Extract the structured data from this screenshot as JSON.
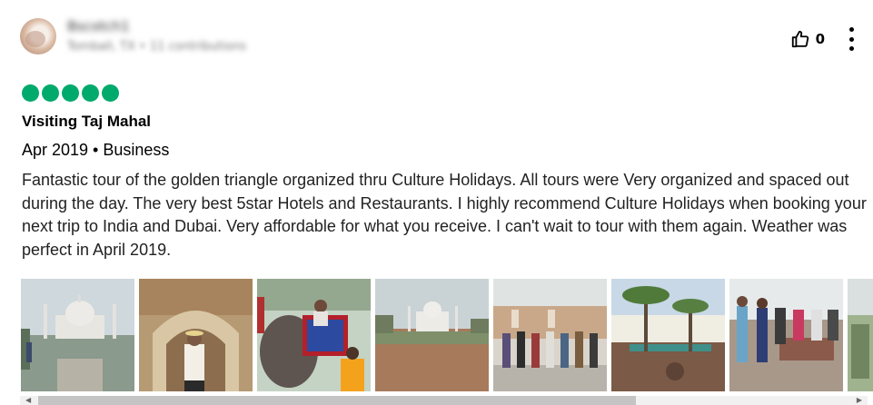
{
  "reviewer": {
    "name": "Bscotch1",
    "meta": "Tomball, TX • 11 contributions",
    "helpful_count": "0"
  },
  "review": {
    "rating": 5,
    "title": "Visiting Taj Mahal",
    "trip": "Apr 2019 • Business",
    "body": "Fantastic tour of the golden triangle organized thru Culture Holidays. All tours were Very organized and spaced out during the day. The very best 5star Hotels and Restaurants. I highly recommend Culture Holidays when booking your next trip to India and Dubai. Very affordable for what you receive. I can't wait to tour with them again. Weather was perfect in April 2019."
  },
  "icons": {
    "helpful": "thumbs-up-icon",
    "more": "more-vertical-icon"
  },
  "colors": {
    "rating_bubble": "#00aa6c"
  }
}
